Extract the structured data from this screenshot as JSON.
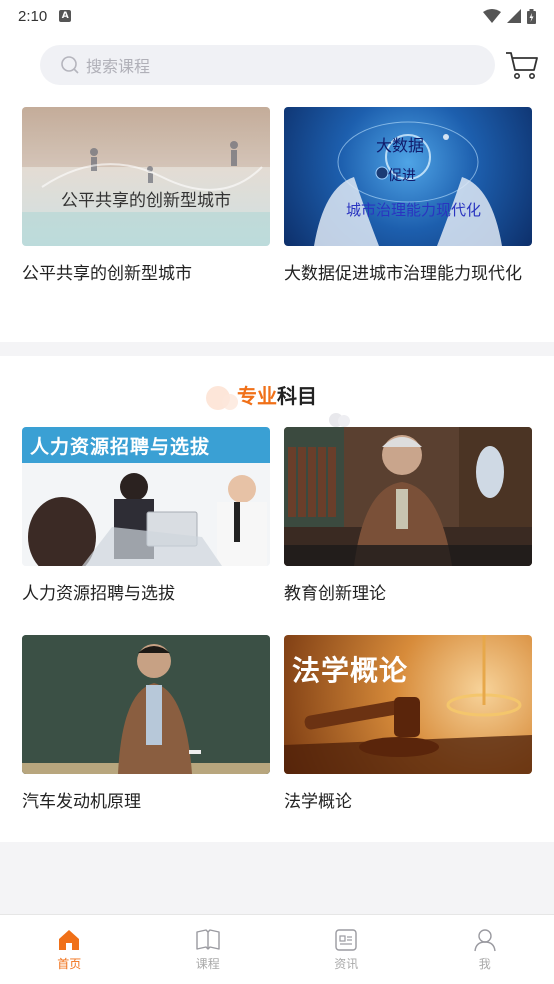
{
  "status_bar": {
    "time": "2:10",
    "notif_badge": "A"
  },
  "search": {
    "placeholder": "搜索课程"
  },
  "featured": [
    {
      "title": "公平共享的创新型城市",
      "overlay": "公平共享的创新型城市"
    },
    {
      "title": "大数据促进城市治理能力现代化",
      "overlay_top": "大数据",
      "overlay_mid": "促进",
      "overlay_bottom": "城市治理能力现代化"
    }
  ],
  "section": {
    "title_highlight": "专业",
    "title_rest": "科目"
  },
  "courses": [
    {
      "title": "人力资源招聘与选拔",
      "banner": "人力资源招聘与选拔"
    },
    {
      "title": "教育创新理论"
    },
    {
      "title": "汽车发动机原理"
    },
    {
      "title": "法学概论",
      "banner": "法学概论"
    }
  ],
  "tabs": [
    {
      "label": "首页",
      "icon": "home-icon",
      "active": true
    },
    {
      "label": "课程",
      "icon": "book-icon",
      "active": false
    },
    {
      "label": "资讯",
      "icon": "news-icon",
      "active": false
    },
    {
      "label": "我",
      "icon": "user-icon",
      "active": false
    }
  ],
  "colors": {
    "accent": "#f07018",
    "inactive": "#aaaaaa"
  }
}
